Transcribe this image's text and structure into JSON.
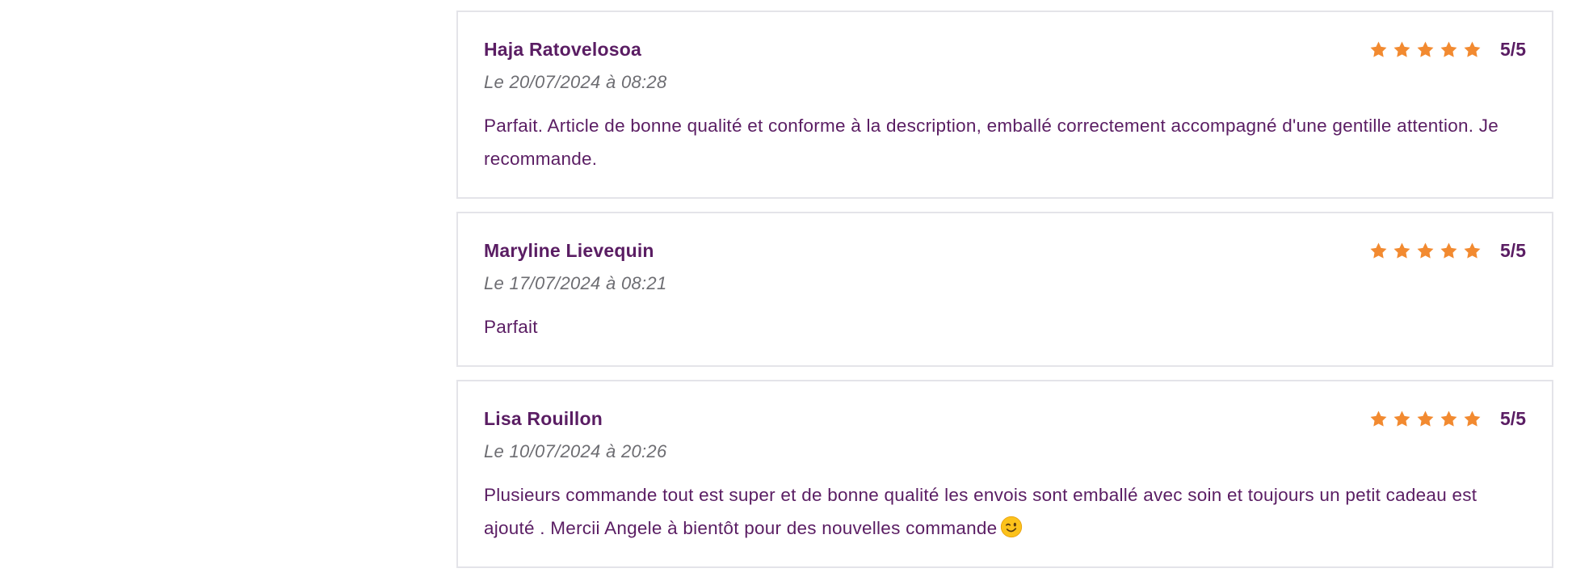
{
  "reviews": [
    {
      "author": "Haja Ratovelosoa",
      "rating": 5,
      "rating_text": "5/5",
      "date": "Le 20/07/2024 à 08:28",
      "text": "Parfait. Article de bonne qualité et conforme à la description, emballé correctement accompagné d'une gentille attention. Je recommande."
    },
    {
      "author": "Maryline Lievequin",
      "rating": 5,
      "rating_text": "5/5",
      "date": "Le 17/07/2024 à 08:21",
      "text": "Parfait"
    },
    {
      "author": "Lisa Rouillon",
      "rating": 5,
      "rating_text": "5/5",
      "date": "Le 10/07/2024 à 20:26",
      "text": "Plusieurs commande tout est super et de bonne qualité les envois sont emballé avec soin et toujours un petit cadeau est ajouté . Mercii Angele à bientôt pour des nouvelles commande",
      "emoji": "winking-face-emoji"
    }
  ],
  "colors": {
    "star": "#f28a30",
    "text": "#5a1d63",
    "date": "#6d6d72",
    "border": "#e4e4e9"
  },
  "icons": {
    "star": "star-icon",
    "emoji": "winking-face-emoji"
  }
}
